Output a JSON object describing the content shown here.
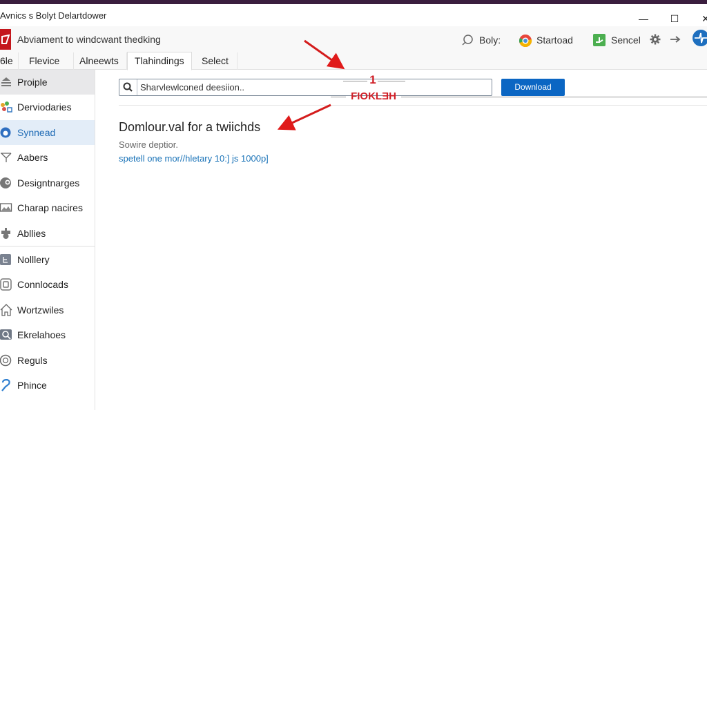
{
  "window": {
    "title": "Avnics s Bolyt Delartdower",
    "controls": {
      "minimize": "—",
      "maximize": "☐",
      "close": "✕"
    }
  },
  "toolbar": {
    "app_heading": "Abviament to windcwant thedking",
    "items": [
      {
        "icon": "search-icon",
        "label": "Boly:"
      },
      {
        "icon": "chrome-icon",
        "label": "Startoad"
      },
      {
        "icon": "green-app-icon",
        "label": "Sencel"
      }
    ],
    "settings_icon": "gear-icon",
    "arrow_icon": "arrow-right-icon",
    "avatar_icon": "avatar-icon"
  },
  "tabs": [
    {
      "label": "6le",
      "active": false
    },
    {
      "label": "Flevice",
      "active": false
    },
    {
      "label": "Alneewts",
      "active": false
    },
    {
      "label": "Tlahindings",
      "active": true
    },
    {
      "label": "Select",
      "active": false
    }
  ],
  "sidebar": {
    "items": [
      {
        "label": "Proiple",
        "icon": "people-icon",
        "state": "highlighted"
      },
      {
        "label": "Derviodaries",
        "icon": "apps-icon",
        "state": "normal"
      },
      {
        "label": "Synnead",
        "icon": "sync-icon",
        "state": "active"
      },
      {
        "label": "Aabers",
        "icon": "filter-icon",
        "state": "normal"
      },
      {
        "label": "Designtnarges",
        "icon": "design-icon",
        "state": "normal"
      },
      {
        "label": "Charap nacires",
        "icon": "image-icon",
        "state": "normal"
      },
      {
        "label": "Abllies",
        "icon": "plugin-icon",
        "state": "normal"
      },
      {
        "label": "Nolllery",
        "icon": "gallery-icon",
        "state": "normal"
      },
      {
        "label": "Connlocads",
        "icon": "download-box-icon",
        "state": "normal"
      },
      {
        "label": "Wortzwiles",
        "icon": "home-icon",
        "state": "normal"
      },
      {
        "label": "Ekrelahoes",
        "icon": "search-box-icon",
        "state": "normal"
      },
      {
        "label": "Reguls",
        "icon": "smiley-icon",
        "state": "normal"
      },
      {
        "label": "Phince",
        "icon": "help-icon",
        "state": "normal"
      }
    ]
  },
  "main": {
    "search": {
      "placeholder": "Sharvlewlconed deesiion..",
      "value": ""
    },
    "download_button": "Download",
    "annotation": {
      "number": "1",
      "label": "FIOKLƎH"
    },
    "headline": "Domlour.val for a twiichds",
    "description": "Sowire deptior.",
    "link_text": "spetell one mor//hletary 10:] js 1000p]"
  },
  "colors": {
    "accent": "#0b66c3",
    "annotation_red": "#d01e26",
    "title_strip": "#3a1e3e",
    "active_sidebar_bg": "#e3edf8",
    "link": "#1a73b8"
  }
}
